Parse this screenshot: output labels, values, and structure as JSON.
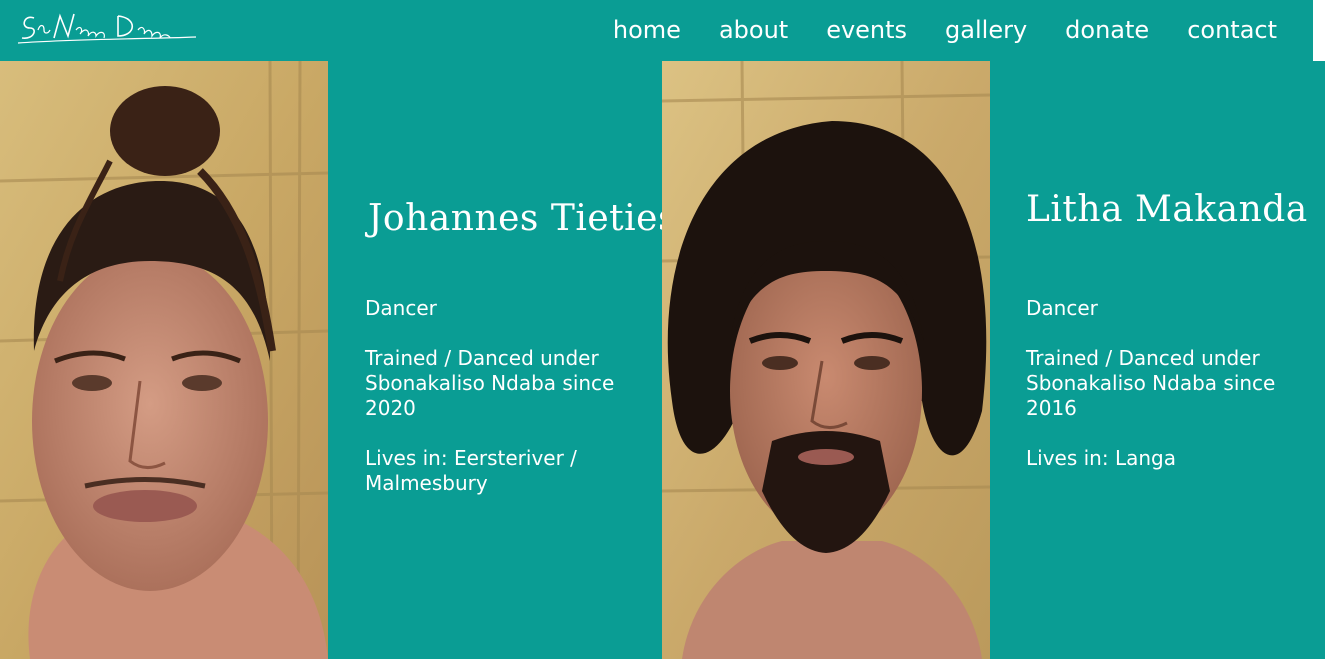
{
  "site": {
    "logo_text": "SboNdaba Dance"
  },
  "nav": {
    "items": [
      "home",
      "about",
      "events",
      "gallery",
      "donate",
      "contact"
    ]
  },
  "members": [
    {
      "name": "Johannes Tieties",
      "role": "Dancer",
      "training": "Trained / Danced under Sbonakaliso Ndaba since 2020",
      "lives": "Lives in: Eersteriver / Malmesbury"
    },
    {
      "name": "Litha Makanda",
      "role": "Dancer",
      "training": "Trained / Danced under Sbonakaliso Ndaba since 2016",
      "lives": "Lives in: Langa"
    }
  ],
  "colors": {
    "background": "#0a9d94",
    "text": "#ffffff"
  }
}
